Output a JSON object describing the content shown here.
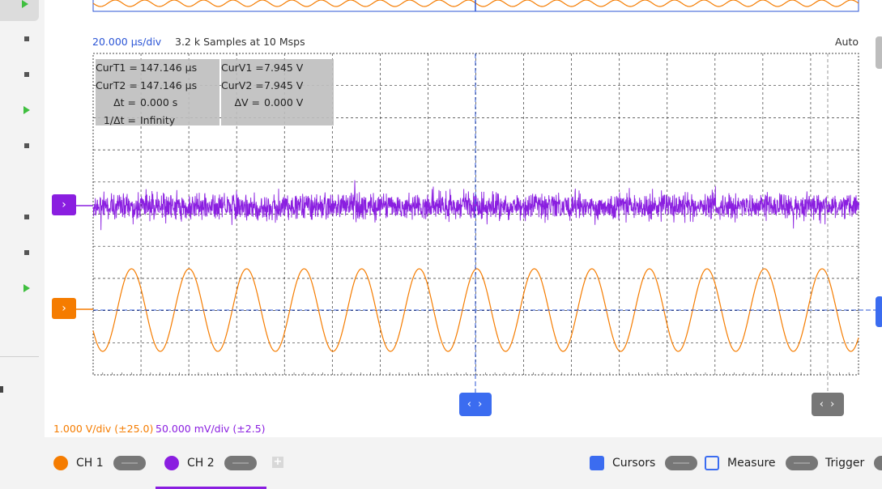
{
  "header": {
    "timebase": "20.000 µs/div",
    "samples": "3.2 k Samples at 10 Msps",
    "trigger_mode": "Auto"
  },
  "cursor_readout": {
    "time": [
      {
        "label": "CurT1 =",
        "value": "147.146 µs"
      },
      {
        "label": "CurT2 =",
        "value": "147.146 µs"
      },
      {
        "label": "Δt =",
        "value": "0.000 s"
      },
      {
        "label": "1/Δt =",
        "value": "Infinity"
      }
    ],
    "voltage": [
      {
        "label": "CurV1 =",
        "value": "7.945 V"
      },
      {
        "label": "CurV2 =",
        "value": "7.945 V"
      },
      {
        "label": "ΔV =",
        "value": "0.000 V"
      }
    ]
  },
  "scales": {
    "ch1": "1.000 V/div (±25.0)",
    "ch2": "50.000 mV/div (±2.5)"
  },
  "channel_markers": {
    "ch1_glyph": "›",
    "ch2_glyph": "›"
  },
  "handles": {
    "time_cursor": "‹ ›",
    "second_cursor": "‹ ›"
  },
  "bottom_bar": {
    "tabs": [
      {
        "label": "CH 1",
        "color": "#f57c00"
      },
      {
        "label": "CH 2",
        "color": "#8a1ee0"
      }
    ],
    "add_label": "+",
    "tools": [
      {
        "label": "Cursors"
      },
      {
        "label": "Measure"
      },
      {
        "label": "Trigger"
      }
    ]
  },
  "colors": {
    "ch1": "#f57c00",
    "ch2": "#8a1ee0",
    "cursor": "#2b55d6",
    "grid": "#333333",
    "active_tool": "#3b6cf0"
  },
  "waveforms": {
    "ch1": {
      "shape": "sine",
      "cycles_in_view": 13.3
    },
    "ch2": {
      "shape": "noise"
    }
  }
}
